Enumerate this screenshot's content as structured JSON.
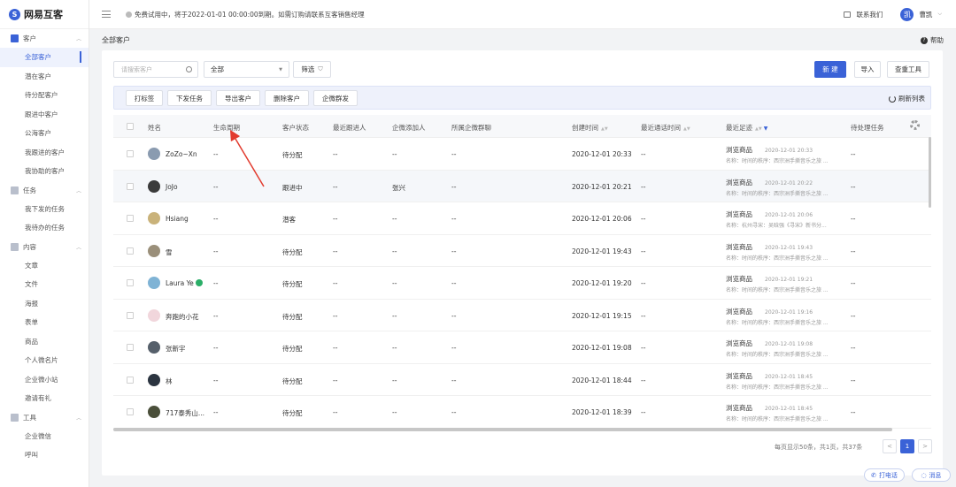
{
  "app": {
    "logo_mark": "S",
    "name": "网易互客"
  },
  "topbar": {
    "notice": "免费试用中，将于2022-01-01 00:00:00到期。如需订购请联系互客销售经理",
    "contact": "联系我们",
    "avatar_char": "凯",
    "user": "曹凯"
  },
  "sidebar": {
    "groups": [
      {
        "label": "客户",
        "items": [
          "全部客户",
          "潜在客户",
          "待分配客户",
          "跟进中客户",
          "公海客户",
          "我跟进的客户",
          "我协助的客户"
        ]
      },
      {
        "label": "任务",
        "items": [
          "我下发的任务",
          "我待办的任务"
        ]
      },
      {
        "label": "内容",
        "items": [
          "文章",
          "文件",
          "海报",
          "表单",
          "商品",
          "个人微名片",
          "企业微小站",
          "邀请有礼"
        ]
      },
      {
        "label": "工具",
        "items": [
          "企业微信",
          "呼叫"
        ]
      }
    ]
  },
  "page": {
    "breadcrumb": "全部客户",
    "help": "帮助"
  },
  "toolbar": {
    "search_placeholder": "请搜索客户",
    "select_value": "全部",
    "filter": "筛选",
    "new": "新 建",
    "import": "导入",
    "dedupe": "查重工具"
  },
  "actions": {
    "tag": "打标签",
    "task": "下发任务",
    "export": "导出客户",
    "delete": "删除客户",
    "group_msg": "企微群发",
    "refresh": "刷新列表"
  },
  "columns": {
    "name": "姓名",
    "lifecycle": "生命周期",
    "status": "客户状态",
    "owner": "最近跟进人",
    "adder": "企微添加人",
    "group": "所属企微群聊",
    "created": "创建时间",
    "last_contact": "最近通话时间",
    "last_track": "最近足迹",
    "pending": "待处理任务"
  },
  "rows": [
    {
      "name": "ZoZo~Xn",
      "lifecycle": "--",
      "status": "待分配",
      "owner": "--",
      "adder": "--",
      "group": "--",
      "created": "2020-12-01 20:33",
      "last_contact": "--",
      "track_title": "浏览商品",
      "track_time": "2020-12-01 20:33",
      "track_sub": "名称：时间的秩序：西宗洲手撕音乐之旅 ...",
      "pending": "--",
      "avatar_color": "#8a9bb0"
    },
    {
      "name": "JoJo",
      "lifecycle": "--",
      "status": "跟进中",
      "owner": "--",
      "adder": "张兴",
      "group": "--",
      "created": "2020-12-01 20:21",
      "last_contact": "--",
      "track_title": "浏览商品",
      "track_time": "2020-12-01 20:22",
      "track_sub": "名称：时间的秩序：西宗洲手撕音乐之旅 ...",
      "pending": "--",
      "avatar_color": "#3b3b3b"
    },
    {
      "name": "Hsiang",
      "lifecycle": "--",
      "status": "潜客",
      "owner": "--",
      "adder": "--",
      "group": "--",
      "created": "2020-12-01 20:06",
      "last_contact": "--",
      "track_title": "浏览商品",
      "track_time": "2020-12-01 20:06",
      "track_sub": "名称：杭州寻宋：吴晗强《寻宋》新书分...",
      "pending": "--",
      "avatar_color": "#c9b27a"
    },
    {
      "name": "雪",
      "lifecycle": "--",
      "status": "待分配",
      "owner": "--",
      "adder": "--",
      "group": "--",
      "created": "2020-12-01 19:43",
      "last_contact": "--",
      "track_title": "浏览商品",
      "track_time": "2020-12-01 19:43",
      "track_sub": "名称：时间的秩序：西宗洲手撕音乐之旅 ...",
      "pending": "--",
      "avatar_color": "#9a8f7a"
    },
    {
      "name": "Laura Ye",
      "lifecycle": "--",
      "status": "待分配",
      "owner": "--",
      "adder": "--",
      "group": "--",
      "created": "2020-12-01 19:20",
      "last_contact": "--",
      "track_title": "浏览商品",
      "track_time": "2020-12-01 19:21",
      "track_sub": "名称：时间的秩序：西宗洲手撕音乐之旅 ...",
      "pending": "--",
      "avatar_color": "#7fb3d5"
    },
    {
      "name": "奔跑的小花",
      "lifecycle": "--",
      "status": "待分配",
      "owner": "--",
      "adder": "--",
      "group": "--",
      "created": "2020-12-01 19:15",
      "last_contact": "--",
      "track_title": "浏览商品",
      "track_time": "2020-12-01 19:16",
      "track_sub": "名称：时间的秩序：西宗洲手撕音乐之旅 ...",
      "pending": "--",
      "avatar_color": "#f1d6dc"
    },
    {
      "name": "张新宇",
      "lifecycle": "--",
      "status": "待分配",
      "owner": "--",
      "adder": "--",
      "group": "--",
      "created": "2020-12-01 19:08",
      "last_contact": "--",
      "track_title": "浏览商品",
      "track_time": "2020-12-01 19:08",
      "track_sub": "名称：时间的秩序：西宗洲手撕音乐之旅 ...",
      "pending": "--",
      "avatar_color": "#56606b"
    },
    {
      "name": "林",
      "lifecycle": "--",
      "status": "待分配",
      "owner": "--",
      "adder": "--",
      "group": "--",
      "created": "2020-12-01 18:44",
      "last_contact": "--",
      "track_title": "浏览商品",
      "track_time": "2020-12-01 18:45",
      "track_sub": "名称：时间的秩序：西宗洲手撕音乐之旅 ...",
      "pending": "--",
      "avatar_color": "#2b3440"
    },
    {
      "name": "717泰秀山...",
      "lifecycle": "--",
      "status": "待分配",
      "owner": "--",
      "adder": "--",
      "group": "--",
      "created": "2020-12-01 18:39",
      "last_contact": "--",
      "track_title": "浏览商品",
      "track_time": "2020-12-01 18:45",
      "track_sub": "名称：时间的秩序：西宗洲手撕音乐之旅 ...",
      "pending": "--",
      "avatar_color": "#4a4f3a"
    }
  ],
  "pagination": {
    "info": "每页显示50条，共1页，共37条",
    "prev": "<",
    "current": "1",
    "next": ">"
  },
  "floats": {
    "call": "打电话",
    "message": "消息"
  },
  "colors": {
    "accent": "#3a62d7",
    "annotation": "#e23b2e"
  }
}
